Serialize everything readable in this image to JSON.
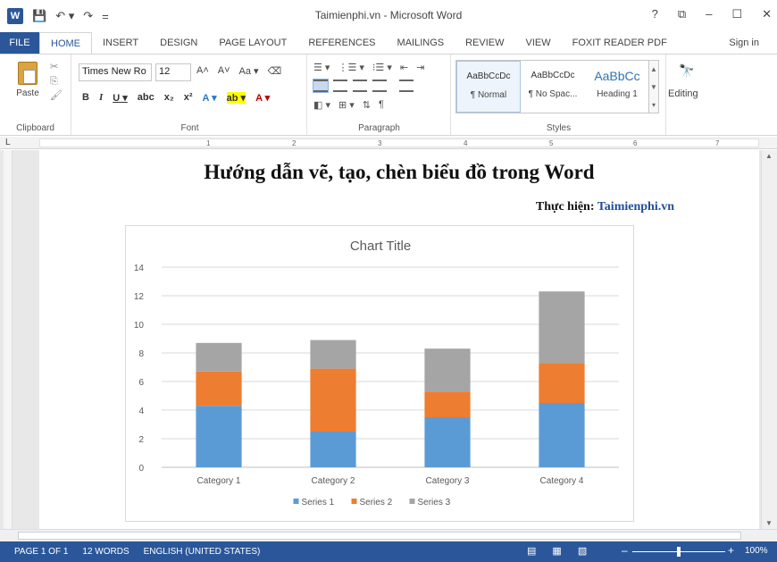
{
  "window": {
    "title": "Taimienphi.vn - Microsoft Word",
    "help": "?",
    "restore": "⧉",
    "minimize": "–",
    "maximize": "☐",
    "close": "✕"
  },
  "qat": {
    "logo": "W",
    "save": "💾",
    "undo": "↶ ▾",
    "redo": "↷",
    "more": "="
  },
  "tabs": {
    "file": "FILE",
    "items": [
      "HOME",
      "INSERT",
      "DESIGN",
      "PAGE LAYOUT",
      "REFERENCES",
      "MAILINGS",
      "REVIEW",
      "VIEW",
      "FOXIT READER PDF"
    ],
    "signin": "Sign in"
  },
  "ribbon": {
    "clipboard": {
      "paste": "Paste",
      "label": "Clipboard",
      "cut": "✂",
      "copy": "⎘",
      "format_painter": "🖌"
    },
    "font": {
      "name": "Times New Ro",
      "size": "12",
      "row1": [
        "A˄",
        "A˅",
        "Aa ▾",
        "⌫"
      ],
      "row2": [
        "B",
        "I",
        "U ▾",
        "abc",
        "x₂",
        "x²",
        "A ▾",
        "ab ▾",
        "A ▾"
      ],
      "label": "Font"
    },
    "paragraph": {
      "row1": [
        "☰ ▾",
        "⋮☰ ▾",
        "⁝☰ ▾",
        "⇤",
        "⇥"
      ],
      "row3": [
        "◧ ▾",
        "⊞ ▾",
        "⇅",
        "¶"
      ],
      "label": "Paragraph"
    },
    "styles": {
      "items": [
        {
          "preview": "AaBbCcDc",
          "name": "¶ Normal"
        },
        {
          "preview": "AaBbCcDc",
          "name": "¶ No Spac..."
        },
        {
          "preview": "AaBbCc",
          "name": "Heading 1"
        }
      ],
      "label": "Styles"
    },
    "editing": {
      "label": "Editing",
      "icon": "🔭"
    }
  },
  "ruler": {
    "tab_marker": "L",
    "numbers": [
      "1",
      "2",
      "3",
      "4",
      "5",
      "6",
      "7"
    ]
  },
  "document": {
    "title": "Hướng dẫn vẽ, tạo, chèn biểu đồ trong Word",
    "author_label": "Thực hiện:",
    "author_site": "Taimienphi.vn"
  },
  "chart_data": {
    "type": "bar",
    "stacked": true,
    "title": "Chart Title",
    "xlabel": "",
    "ylabel": "",
    "categories": [
      "Category 1",
      "Category 2",
      "Category 3",
      "Category 4"
    ],
    "series": [
      {
        "name": "Series 1",
        "values": [
          4.3,
          2.5,
          3.5,
          4.5
        ],
        "color": "#5b9bd5"
      },
      {
        "name": "Series 2",
        "values": [
          2.4,
          4.4,
          1.8,
          2.8
        ],
        "color": "#ed7d31"
      },
      {
        "name": "Series 3",
        "values": [
          2.0,
          2.0,
          3.0,
          5.0
        ],
        "color": "#a5a5a5"
      }
    ],
    "ylim": [
      0,
      14
    ],
    "yticks": [
      0,
      2,
      4,
      6,
      8,
      10,
      12,
      14
    ],
    "grid": true,
    "legend_position": "bottom"
  },
  "statusbar": {
    "page": "PAGE 1 OF 1",
    "words": "12 WORDS",
    "language": "ENGLISH (UNITED STATES)",
    "view_icons": [
      "▤",
      "▦",
      "▧"
    ],
    "zoom_minus": "–",
    "zoom_plus": "+",
    "zoom": "100%",
    "zoom_level": 1.0
  }
}
